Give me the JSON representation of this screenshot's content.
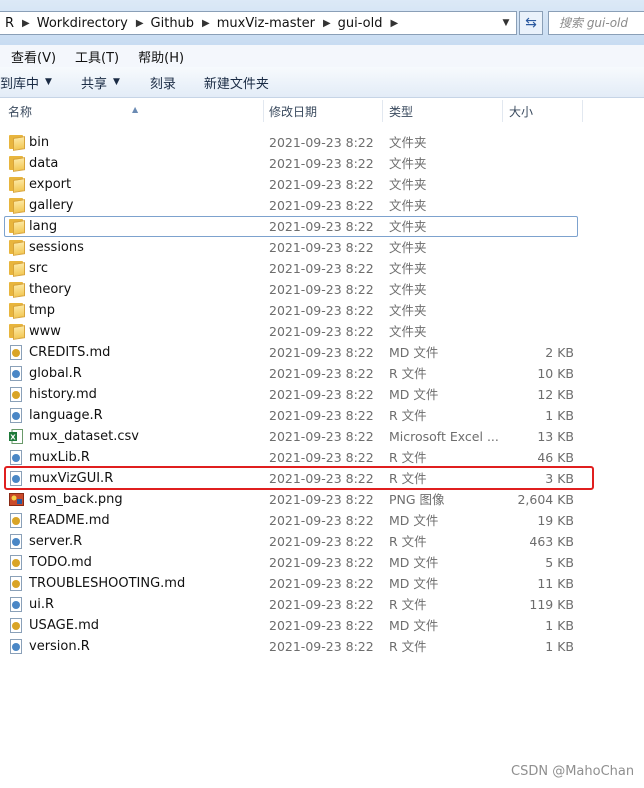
{
  "window": {
    "breadcrumbs": [
      "R",
      "Workdirectory",
      "Github",
      "muxViz-master",
      "gui-old"
    ],
    "search_placeholder": "搜索 gui-old"
  },
  "menu": [
    "查看(V)",
    "工具(T)",
    "帮助(H)"
  ],
  "toolbar": {
    "include_library": "到库中",
    "share": "共享",
    "burn": "刻录",
    "new_folder": "新建文件夹"
  },
  "columns": {
    "name": "名称",
    "date": "修改日期",
    "type": "类型",
    "size": "大小"
  },
  "files": [
    {
      "name": "bin",
      "date": "2021-09-23 8:22",
      "type": "文件夹",
      "size": "",
      "icon": "folder-icon"
    },
    {
      "name": "data",
      "date": "2021-09-23 8:22",
      "type": "文件夹",
      "size": "",
      "icon": "folder-icon"
    },
    {
      "name": "export",
      "date": "2021-09-23 8:22",
      "type": "文件夹",
      "size": "",
      "icon": "folder-icon"
    },
    {
      "name": "gallery",
      "date": "2021-09-23 8:22",
      "type": "文件夹",
      "size": "",
      "icon": "folder-icon"
    },
    {
      "name": "lang",
      "date": "2021-09-23 8:22",
      "type": "文件夹",
      "size": "",
      "icon": "folder-icon"
    },
    {
      "name": "sessions",
      "date": "2021-09-23 8:22",
      "type": "文件夹",
      "size": "",
      "icon": "folder-icon"
    },
    {
      "name": "src",
      "date": "2021-09-23 8:22",
      "type": "文件夹",
      "size": "",
      "icon": "folder-icon"
    },
    {
      "name": "theory",
      "date": "2021-09-23 8:22",
      "type": "文件夹",
      "size": "",
      "icon": "folder-icon"
    },
    {
      "name": "tmp",
      "date": "2021-09-23 8:22",
      "type": "文件夹",
      "size": "",
      "icon": "folder-icon"
    },
    {
      "name": "www",
      "date": "2021-09-23 8:22",
      "type": "文件夹",
      "size": "",
      "icon": "folder-icon"
    },
    {
      "name": "CREDITS.md",
      "date": "2021-09-23 8:22",
      "type": "MD 文件",
      "size": "2 KB",
      "icon": "md-file-icon"
    },
    {
      "name": "global.R",
      "date": "2021-09-23 8:22",
      "type": "R 文件",
      "size": "10 KB",
      "icon": "r-file-icon"
    },
    {
      "name": "history.md",
      "date": "2021-09-23 8:22",
      "type": "MD 文件",
      "size": "12 KB",
      "icon": "md-file-icon"
    },
    {
      "name": "language.R",
      "date": "2021-09-23 8:22",
      "type": "R 文件",
      "size": "1 KB",
      "icon": "r-file-icon"
    },
    {
      "name": "mux_dataset.csv",
      "date": "2021-09-23 8:22",
      "type": "Microsoft Excel ...",
      "size": "13 KB",
      "icon": "excel-file-icon"
    },
    {
      "name": "muxLib.R",
      "date": "2021-09-23 8:22",
      "type": "R 文件",
      "size": "46 KB",
      "icon": "r-file-icon"
    },
    {
      "name": "muxVizGUI.R",
      "date": "2021-09-23 8:22",
      "type": "R 文件",
      "size": "3 KB",
      "icon": "r-file-icon"
    },
    {
      "name": "osm_back.png",
      "date": "2021-09-23 8:22",
      "type": "PNG 图像",
      "size": "2,604 KB",
      "icon": "png-file-icon"
    },
    {
      "name": "README.md",
      "date": "2021-09-23 8:22",
      "type": "MD 文件",
      "size": "19 KB",
      "icon": "md-file-icon"
    },
    {
      "name": "server.R",
      "date": "2021-09-23 8:22",
      "type": "R 文件",
      "size": "463 KB",
      "icon": "r-file-icon"
    },
    {
      "name": "TODO.md",
      "date": "2021-09-23 8:22",
      "type": "MD 文件",
      "size": "5 KB",
      "icon": "md-file-icon"
    },
    {
      "name": "TROUBLESHOOTING.md",
      "date": "2021-09-23 8:22",
      "type": "MD 文件",
      "size": "11 KB",
      "icon": "md-file-icon"
    },
    {
      "name": "ui.R",
      "date": "2021-09-23 8:22",
      "type": "R 文件",
      "size": "119 KB",
      "icon": "r-file-icon"
    },
    {
      "name": "USAGE.md",
      "date": "2021-09-23 8:22",
      "type": "MD 文件",
      "size": "1 KB",
      "icon": "md-file-icon"
    },
    {
      "name": "version.R",
      "date": "2021-09-23 8:22",
      "type": "R 文件",
      "size": "1 KB",
      "icon": "r-file-icon"
    }
  ],
  "focused_row": 4,
  "highlighted_row": 16,
  "watermark": "CSDN @MahoChan",
  "colors": {
    "highlight": "#e01f1f",
    "focus": "#7da2ce",
    "folder": "#f3c957",
    "md_badge": "#d9a426",
    "r_badge": "#4a87c6"
  }
}
